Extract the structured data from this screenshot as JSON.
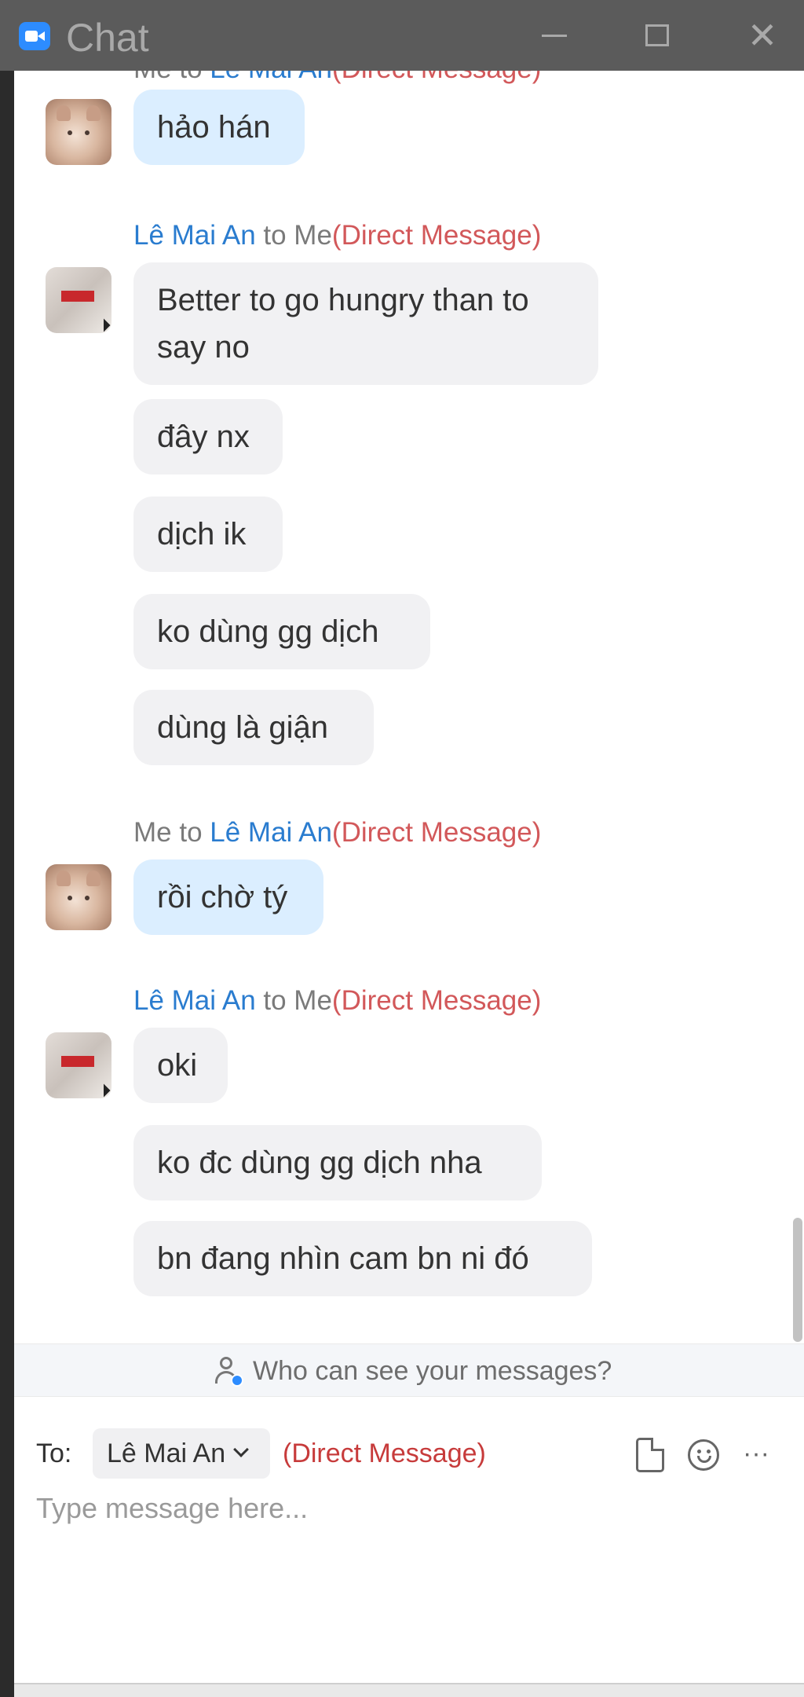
{
  "app": {
    "title": "Chat",
    "logo_icon": "zoom-camera-icon",
    "window_controls": [
      "minimize-icon",
      "maximize-icon",
      "close-icon"
    ],
    "close_glyph": "✕"
  },
  "colors": {
    "titlebar": "#5b5b5b",
    "accent": "#2d8cff",
    "sender_name": "#2a7ccf",
    "direct_message": "#d2585a",
    "bubble_me": "#dbeeff",
    "bubble_other": "#f1f1f3"
  },
  "messages": {
    "partial_header": {
      "from": "Me",
      "to_word": " to ",
      "to": "Lê Mai An",
      "tag": "(Direct Message)"
    },
    "group1": {
      "bubbles": [
        "hảo hán"
      ]
    },
    "group2": {
      "from": "Lê Mai An",
      "to_word": " to ",
      "to": "Me",
      "tag": "(Direct Message)",
      "bubbles": [
        "Better to go hungry than to say no",
        "đây nx",
        "dịch ik",
        "ko dùng gg dịch",
        "dùng là giận"
      ]
    },
    "group3": {
      "from": "Me",
      "to_word": " to ",
      "to": "Lê Mai An",
      "tag": "(Direct Message)",
      "bubbles": [
        "rồi chờ tý"
      ]
    },
    "group4": {
      "from": "Lê Mai An",
      "to_word": " to ",
      "to": "Me",
      "tag": "(Direct Message)",
      "bubbles": [
        "oki",
        "ko đc dùng gg dịch nha",
        "bn đang nhìn cam bn ni đó"
      ]
    }
  },
  "privacy": {
    "icon": "user-privacy-icon",
    "text": "Who can see your messages?"
  },
  "composer": {
    "to_label": "To:",
    "recipient": "Lê Mai An",
    "recipient_dropdown_icon": "chevron-down-icon",
    "message_type": "(Direct Message)",
    "toolbar_icons": [
      "file-icon",
      "emoji-icon",
      "more-icon"
    ],
    "more_glyph": "···",
    "input_value": "",
    "input_placeholder": "Type message here..."
  }
}
